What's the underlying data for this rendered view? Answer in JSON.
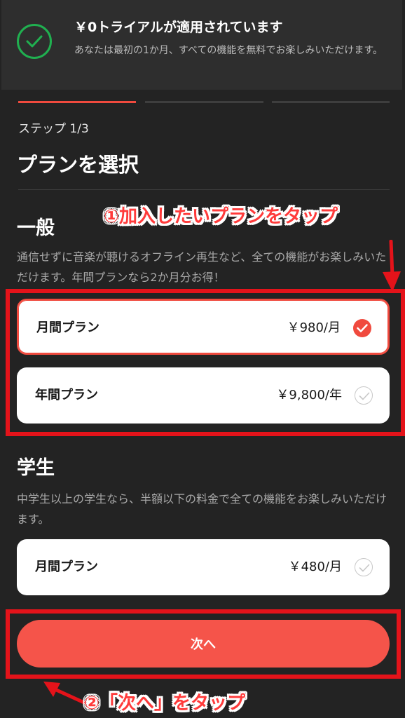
{
  "banner": {
    "title": "￥0トライアルが適用されています",
    "description": "あなたは最初の1か月、すべての機能を無料でお楽しみいただけます。"
  },
  "progress": {
    "current_step": 1,
    "total_steps": 3,
    "step_label": "ステップ 1/3"
  },
  "page_title": "プランを選択",
  "sections": [
    {
      "title": "一般",
      "description": "通信せずに音楽が聴けるオフライン再生など、全ての機能がお楽しみいただけます。年間プランなら2か月分お得！",
      "plans": [
        {
          "name": "月間プラン",
          "price": "￥980/月",
          "selected": true
        },
        {
          "name": "年間プラン",
          "price": "￥9,800/年",
          "selected": false
        }
      ]
    },
    {
      "title": "学生",
      "description": "中学生以上の学生なら、半額以下の料金で全ての機能をお楽しみいただけます。",
      "plans": [
        {
          "name": "月間プラン",
          "price": "￥480/月",
          "selected": false
        }
      ]
    }
  ],
  "next_button": {
    "label": "次へ"
  },
  "annotations": {
    "step1": "①加入したいプランをタップ",
    "step2": "②「次へ」をタップ"
  },
  "colors": {
    "accent": "#f04a3e",
    "button": "#f5544a",
    "success": "#20b050",
    "annotation": "#e4131a",
    "background": "#232323"
  },
  "icons": {
    "banner": "check-circle-icon",
    "selected": "check-filled-icon",
    "unselected": "check-outline-icon"
  }
}
